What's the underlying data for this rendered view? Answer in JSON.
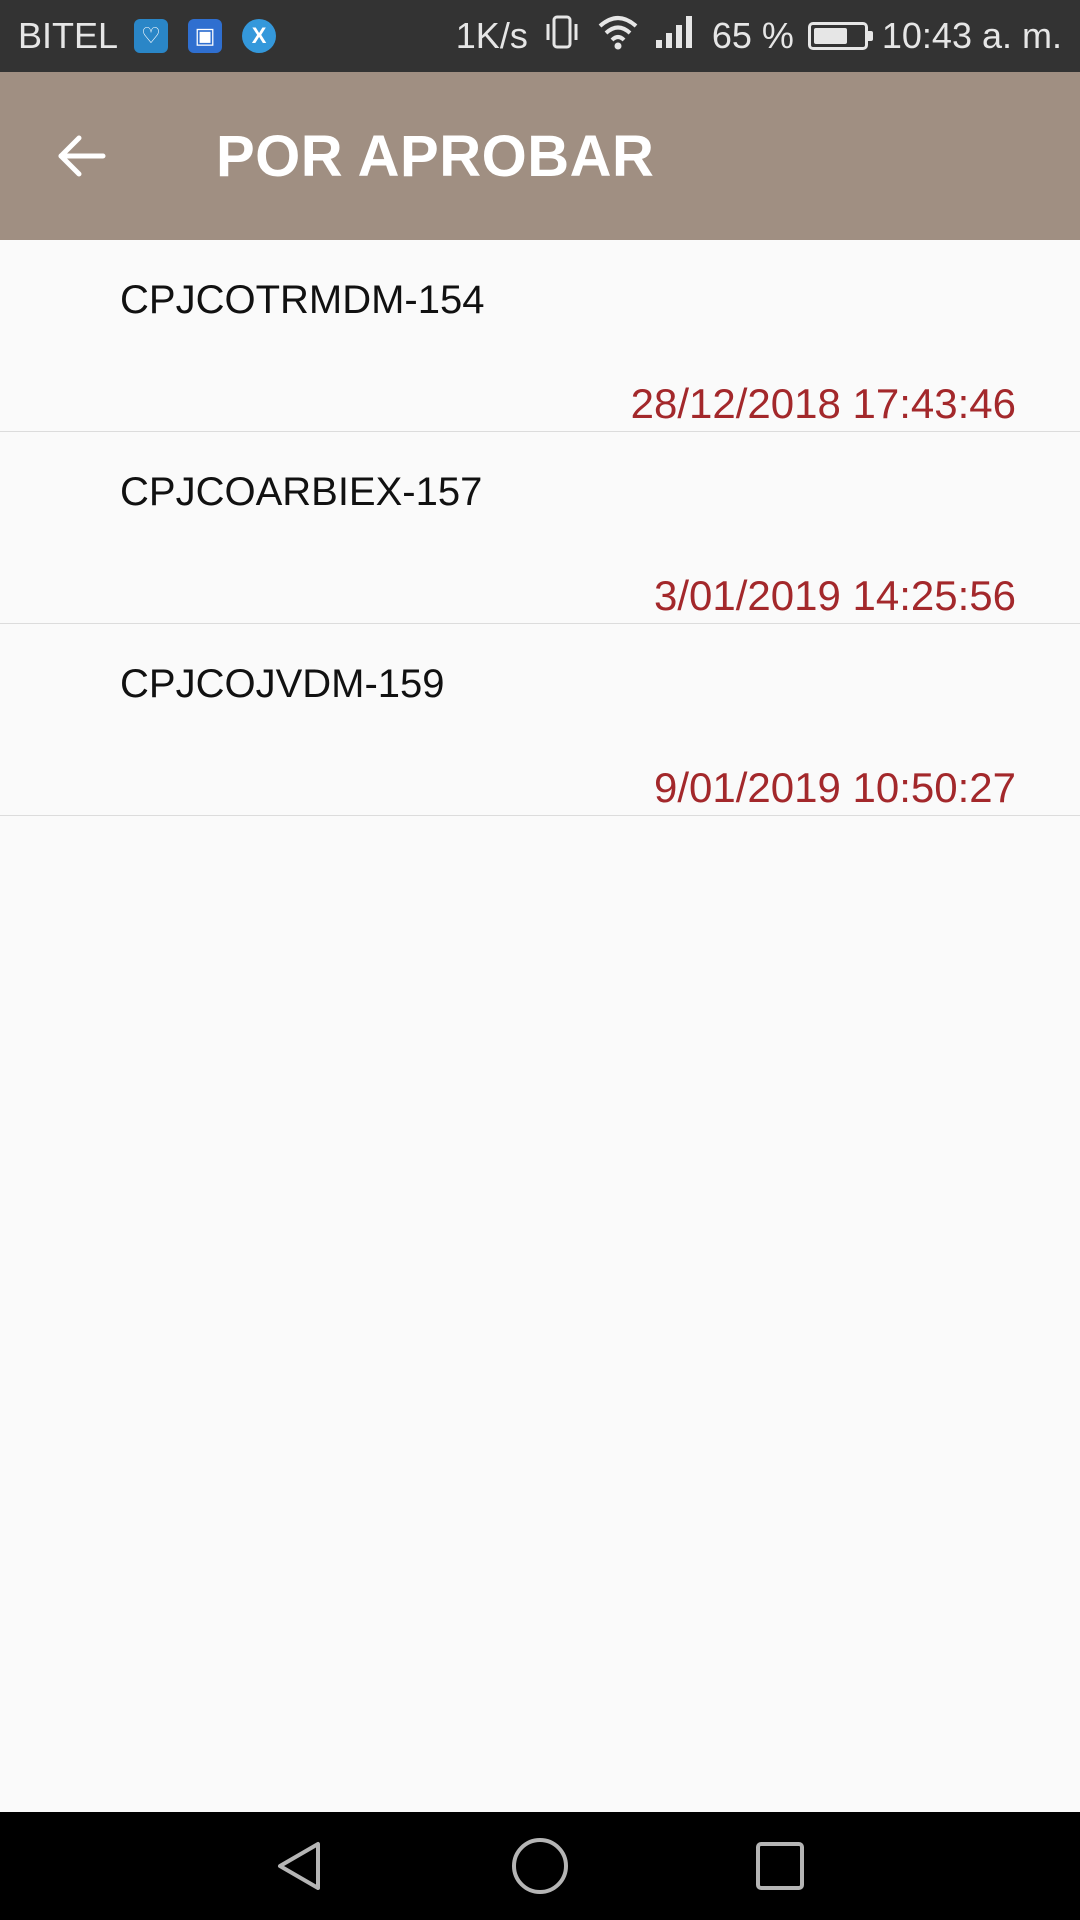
{
  "status_bar": {
    "carrier": "BITEL",
    "app_icons": [
      {
        "name": "health-app-icon",
        "color": "#2a86c7",
        "glyph": "♡"
      },
      {
        "name": "gallery-app-icon",
        "color": "#2f6fd0",
        "glyph": "▣"
      },
      {
        "name": "xamarin-app-icon",
        "color": "#3498db",
        "glyph": "X"
      }
    ],
    "net_speed": "1K/s",
    "battery_percent": "65 %",
    "battery_level": 0.65,
    "time": "10:43 a. m."
  },
  "app_bar": {
    "title": "POR APROBAR",
    "background": "#a08f82"
  },
  "items": [
    {
      "code": "CPJCOTRMDM-154",
      "date": "28/12/2018 17:43:46"
    },
    {
      "code": "CPJCOARBIEX-157",
      "date": "3/01/2019 14:25:56"
    },
    {
      "code": "CPJCOJVDM-159",
      "date": "9/01/2019 10:50:27"
    }
  ],
  "colors": {
    "date_text": "#a3282b",
    "status_bar": "#333333",
    "nav_bar": "#000000"
  },
  "nav_bar": {
    "buttons": [
      "back",
      "home",
      "recents"
    ]
  }
}
